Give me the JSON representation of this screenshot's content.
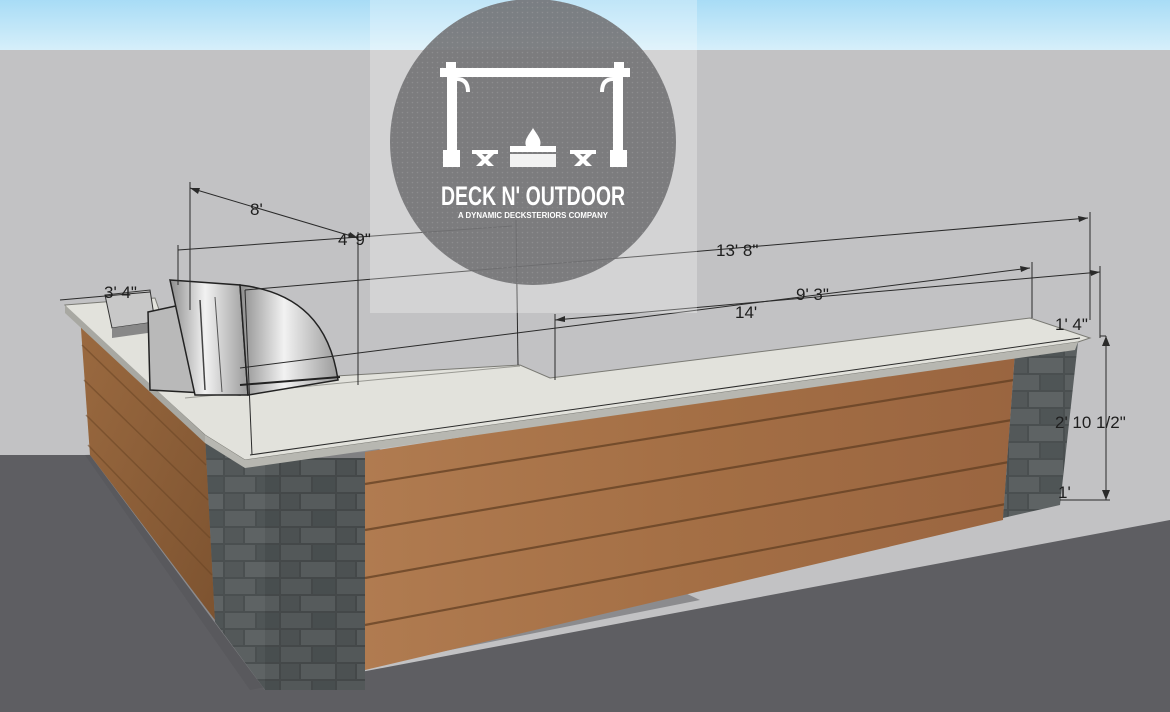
{
  "watermark": {
    "brand": "DECK N' OUTDOOR",
    "tagline": "A DYNAMIC DECKSTERIORS COMPANY"
  },
  "dimensions": {
    "overall_left_depth": "8'",
    "grill_offset": "4' 9\"",
    "left_return_width": "3' 4\"",
    "back_length": "13' 8\"",
    "bar_run": "9' 3\"",
    "front_length": "14'",
    "counter_depth": "1' 4\"",
    "height": "2' 10 1/2\"",
    "base_height": "1'"
  },
  "colors": {
    "sky": "#c0e6f8",
    "ground_far": "#c2c2c4",
    "ground_near": "#5e5e62",
    "wood": "#a9744a",
    "stone": "#4d5253",
    "countertop": "#dcdcd6",
    "watermark": "#6f6f72"
  },
  "icons": [
    "pergola-icon",
    "fire-pit-icon",
    "bench-icon"
  ]
}
